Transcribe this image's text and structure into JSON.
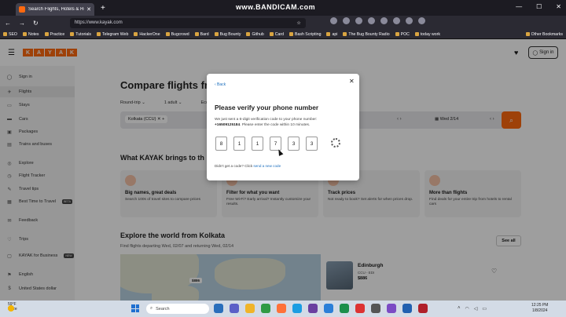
{
  "browser": {
    "tab_title": "Search Flights, Hotels & Rental Cars",
    "url": "https://www.kayak.com",
    "watermark": "www.BANDICAM.com",
    "bookmarks": [
      "SEO",
      "Notes",
      "Practice",
      "Tutorials",
      "Telegram Web",
      "HackerOne",
      "Bugcrowd",
      "Bard",
      "Bug Bounty",
      "Github",
      "Card",
      "Bash Scripting",
      "api",
      "The Bug Bounty Radio",
      "POC",
      "today work"
    ],
    "other_bookmarks": "Other Bookmarks"
  },
  "kayak": {
    "logo_letters": [
      "K",
      "A",
      "Y",
      "A",
      "K"
    ],
    "sign_in_label": "Sign in",
    "sidebar": [
      {
        "label": "Sign in",
        "icon": "person-icon"
      },
      {
        "label": "Flights",
        "icon": "plane-icon",
        "active": true
      },
      {
        "label": "Stays",
        "icon": "bed-icon"
      },
      {
        "label": "Cars",
        "icon": "car-icon"
      },
      {
        "label": "Packages",
        "icon": "suitcase-icon"
      },
      {
        "label": "Trains and buses",
        "icon": "train-icon"
      },
      {
        "label": "Explore",
        "icon": "compass-icon"
      },
      {
        "label": "Flight Tracker",
        "icon": "tracker-icon"
      },
      {
        "label": "Travel tips",
        "icon": "tips-icon"
      },
      {
        "label": "Best Time to Travel",
        "icon": "calendar-icon",
        "badge": "BETA"
      },
      {
        "label": "Feedback",
        "icon": "feedback-icon"
      },
      {
        "label": "Trips",
        "icon": "heart-icon"
      },
      {
        "label": "KAYAK for Business",
        "icon": "briefcase-icon",
        "badge": "NEW"
      },
      {
        "label": "English",
        "icon": "flag-icon"
      },
      {
        "label": "United States dollar",
        "icon": "currency-icon"
      }
    ],
    "main": {
      "title": "Compare flights fr",
      "options": [
        "Round-trip ⌄",
        "1 adult ⌄",
        "Econom"
      ],
      "origin_chip": "Kolkata (CCU)",
      "date": "Wed 2/14",
      "section_title": "What KAYAK brings to th",
      "cards": [
        {
          "title": "Big names, great deals",
          "desc": "Search 100s of travel sites to compare prices"
        },
        {
          "title": "Filter for what you want",
          "desc": "Free Wi-Fi? Early arrival? Instantly customize your results."
        },
        {
          "title": "Track prices",
          "desc": "Not ready to book? Set alerts for when prices drop."
        },
        {
          "title": "More than flights",
          "desc": "Find deals for your entire trip from hotels to rental cars"
        }
      ],
      "explore_title": "Explore the world from Kolkata",
      "explore_sub": "Find flights departing Wed, 02/07 and returning Wed, 02/14",
      "see_all": "See all",
      "map_pin": "$886",
      "destination": {
        "name": "Edinburgh",
        "code": "CCU - EDI",
        "price": "$886"
      }
    }
  },
  "modal": {
    "back": "‹ Back",
    "title": "Please verify your phone number",
    "text_prefix": "We just sent a 6-digit verification code to your phone number:",
    "phone": "+16509125184",
    "text_suffix": ". Please enter the code within 10 minutes.",
    "digits": [
      "8",
      "1",
      "1",
      "7",
      "3",
      "3"
    ],
    "resend_prefix": "Didn't get a code? Click ",
    "resend_link": "send a new code"
  },
  "taskbar": {
    "temp": "59°F",
    "condition": "Haze",
    "search_placeholder": "Search",
    "time": "12:25 PM",
    "date": "1/8/2024"
  }
}
